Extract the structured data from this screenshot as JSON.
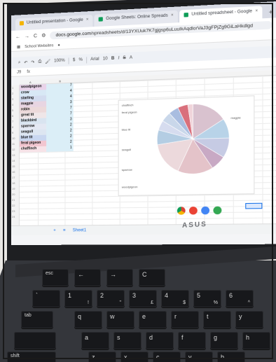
{
  "browser": {
    "tabs": [
      {
        "label": "Untitled presentation - Google",
        "color": "#f4b400"
      },
      {
        "label": "Google Sheets: Online Spreads",
        "color": "#0f9d58"
      },
      {
        "label": "Untitled spreadsheet - Google",
        "color": "#0f9d58"
      }
    ],
    "url_prefix": "docs.google.com",
    "url_rest": "/spreadsheets/d/13YXUuk7K7gjgsp6uLuuIkAqdlorVaJ3gFPjZg9GiLaHkdlgd",
    "bookmark": "School Websites"
  },
  "toolbar": {
    "zoom": "100%",
    "currency": "$",
    "percent": "%",
    "font": "Arial",
    "font_size": "10"
  },
  "formula_bar": {
    "cell_ref": "J9",
    "fx": "fx"
  },
  "columns": {
    "a": "A",
    "b": "B"
  },
  "rows": [
    {
      "bird": "woodpigeon",
      "count": "7",
      "color": "#e9d3e9"
    },
    {
      "bird": "crow",
      "count": "4",
      "color": "#d8e8f5"
    },
    {
      "bird": "starling",
      "count": "4",
      "color": "#d3dcef"
    },
    {
      "bird": "magpie",
      "count": "3",
      "color": "#e8d5e2"
    },
    {
      "bird": "robin",
      "count": "7",
      "color": "#ecd9da"
    },
    {
      "bird": "great tit",
      "count": "7",
      "color": "#efe6e8"
    },
    {
      "bird": "blackbird",
      "count": "3",
      "color": "#d9e4f0"
    },
    {
      "bird": "sparrow",
      "count": "2",
      "color": "#e4e8f3"
    },
    {
      "bird": "seagull",
      "count": "2",
      "color": "#dde6f1"
    },
    {
      "bird": "blue tit",
      "count": "2",
      "color": "#c9d7f0"
    },
    {
      "bird": "feral pigeon",
      "count": "2",
      "color": "#f2c6d0"
    },
    {
      "bird": "chaffinch",
      "count": "1",
      "color": "#f7e3e8"
    }
  ],
  "chart_data": {
    "type": "pie",
    "categories": [
      "woodpigeon",
      "crow",
      "starling",
      "magpie",
      "robin",
      "great tit",
      "blackbird",
      "sparrow",
      "seagull",
      "blue tit",
      "feral pigeon",
      "chaffinch"
    ],
    "values": [
      7,
      4,
      4,
      3,
      7,
      7,
      3,
      2,
      2,
      2,
      2,
      1
    ],
    "colors": [
      "#d9c2cf",
      "#b8d3e8",
      "#c6cbe4",
      "#c8a9c4",
      "#e4c3c9",
      "#ecd9dc",
      "#b4cde3",
      "#d6dcef",
      "#c9d7ea",
      "#a9bde0",
      "#d9707c",
      "#f0d4da"
    ],
    "labels": [
      "chaffinch",
      "feral pigeon",
      "blue tit",
      "seagull",
      "magpie",
      "sparrow",
      "woodpigeon"
    ]
  },
  "sheet_tab": "Sheet1",
  "brand": "ASUS",
  "keyboard": {
    "row0": [
      "esc",
      "←",
      "→",
      "C"
    ],
    "row1": [
      "`",
      "1",
      "2",
      "3",
      "4",
      "5",
      "6"
    ],
    "row1_alt": [
      "",
      "!",
      "\"",
      "£",
      "$",
      "%",
      "^"
    ],
    "row2": [
      "tab",
      "q",
      "w",
      "e",
      "r",
      "t",
      "y"
    ],
    "row3": [
      "",
      "a",
      "s",
      "d",
      "f",
      "g",
      "h"
    ],
    "row4": [
      "shift",
      "z",
      "x",
      "c",
      "v",
      "b"
    ]
  }
}
